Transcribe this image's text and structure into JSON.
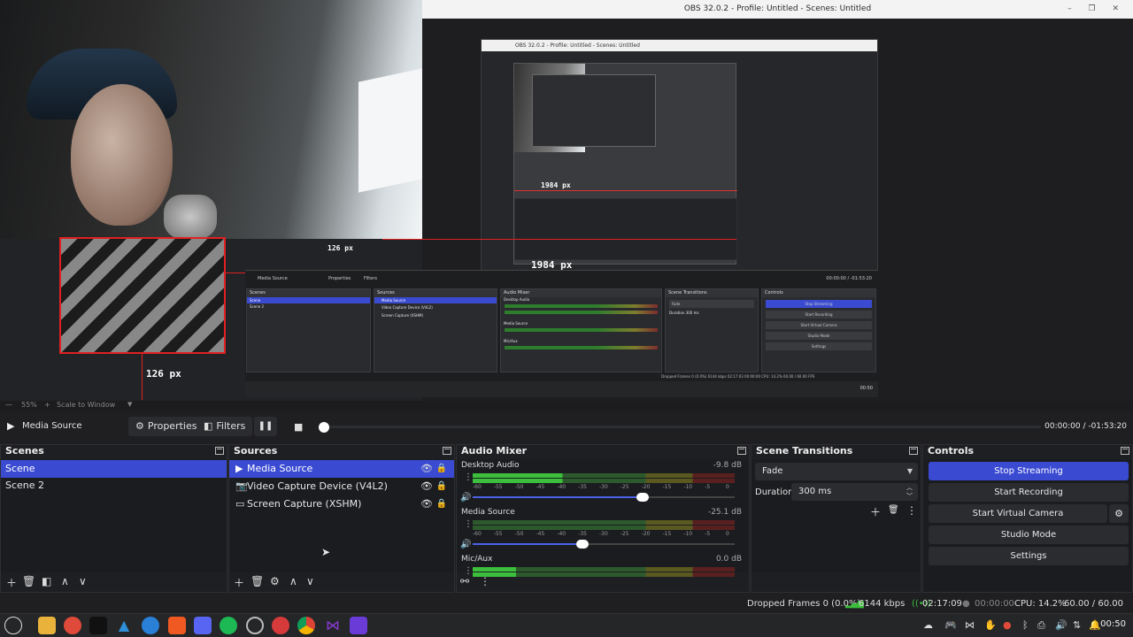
{
  "window": {
    "title": "OBS 32.0.2 - Profile: Untitled - Scenes: Untitled",
    "controls": "– ❐ ✕",
    "nested_title": "OBS 32.0.2 - Profile: Untitled - Scenes: Untitled"
  },
  "preview": {
    "measure_width_label": "1984 px",
    "measure_height_label": "126 px",
    "measure_height_label_small": "126 px"
  },
  "zoom": {
    "percent": "55%",
    "plus": "+",
    "minus": "—",
    "scale_label": "Scale to Window"
  },
  "mini": {
    "media_source": "Media Source",
    "properties": "Properties",
    "filters": "Filters",
    "time": "00:00:00 / -01:53:20",
    "scenes_title": "Scenes",
    "scenes": [
      "Scene",
      "Scene 2"
    ],
    "sources_title": "Sources",
    "sources": [
      "Media Source",
      "Video Capture Device (V4L2)",
      "Screen Capture (XSHM)"
    ],
    "mixer_title": "Audio Mixer",
    "mixer_channels": [
      "Desktop Audio",
      "Media Source",
      "Mic/Aux"
    ],
    "mixer_db": [
      "-9.8 dB",
      "-25.1 dB",
      "0.0 dB"
    ],
    "transitions_title": "Scene Transitions",
    "transition": "Fade",
    "duration_label": "Duration",
    "duration": "300 ms",
    "controls_title": "Controls",
    "controls": [
      "Stop Streaming",
      "Start Recording",
      "Start Virtual Camera",
      "Studio Mode",
      "Settings"
    ],
    "status": "Dropped Frames 0 (0.0%)   6144 kbps   02:17:03   00:00:00   CPU: 14.2%   60.00 / 60.00 FPS",
    "clock": "00:50"
  },
  "media": {
    "play_icon": "▶",
    "name": "Media Source",
    "properties_label": "Properties",
    "filters_label": "Filters",
    "pause_icon": "❚❚",
    "stop_icon": "■",
    "time": "00:00:00  /  -01:53:20",
    "progress_fraction": 0
  },
  "scenes": {
    "title": "Scenes",
    "items": [
      {
        "label": "Scene",
        "selected": true
      },
      {
        "label": "Scene 2",
        "selected": false
      }
    ]
  },
  "sources": {
    "title": "Sources",
    "items": [
      {
        "label": "Media Source",
        "icon": "play-icon",
        "selected": true
      },
      {
        "label": "Video Capture Device (V4L2)",
        "icon": "camera-icon",
        "selected": false
      },
      {
        "label": "Screen Capture (XSHM)",
        "icon": "monitor-icon",
        "selected": false
      }
    ]
  },
  "mixer": {
    "title": "Audio Mixer",
    "scale": [
      "-60",
      "-55",
      "-50",
      "-45",
      "-40",
      "-35",
      "-30",
      "-25",
      "-20",
      "-15",
      "-10",
      "-5",
      "0"
    ],
    "channels": [
      {
        "name": "Desktop Audio",
        "db": "-9.8 dB",
        "level_fraction": 0.52,
        "volume_fraction": 0.65
      },
      {
        "name": "Media Source",
        "db": "-25.1 dB",
        "level_fraction": 0.0,
        "volume_fraction": 0.42
      },
      {
        "name": "Mic/Aux",
        "db": "0.0 dB",
        "level_fraction": 0.25,
        "volume_fraction": 0.0
      }
    ]
  },
  "transitions": {
    "title": "Scene Transitions",
    "selected": "Fade",
    "duration_label": "Duration",
    "duration_value": "300 ms"
  },
  "controls": {
    "title": "Controls",
    "buttons": [
      {
        "label": "Stop Streaming",
        "active": true
      },
      {
        "label": "Start Recording",
        "active": false
      },
      {
        "label": "Start Virtual Camera",
        "active": false
      },
      {
        "label": "Studio Mode",
        "active": false
      },
      {
        "label": "Settings",
        "active": false
      }
    ]
  },
  "status": {
    "dropped_frames": "Dropped Frames 0 (0.0%)",
    "bitrate": "6144 kbps",
    "stream_time": "02:17:09",
    "record_time": "00:00:00",
    "cpu": "CPU: 14.2%",
    "fps": "60.00 / 60.00 FPS"
  },
  "taskbar": {
    "clock": "00:50",
    "apps": [
      "menu",
      "files",
      "app-red",
      "terminal",
      "arch",
      "browser-blue",
      "brave",
      "discord",
      "spotify",
      "steam",
      "obs",
      "chrome",
      "aseprite",
      "visual-studio"
    ]
  },
  "colors": {
    "accent": "#3a4bd2",
    "meter_green": "#3cbf3c",
    "meter_yellow": "#bfbf30",
    "meter_red": "#c03030",
    "measure_red": "#e02020"
  }
}
